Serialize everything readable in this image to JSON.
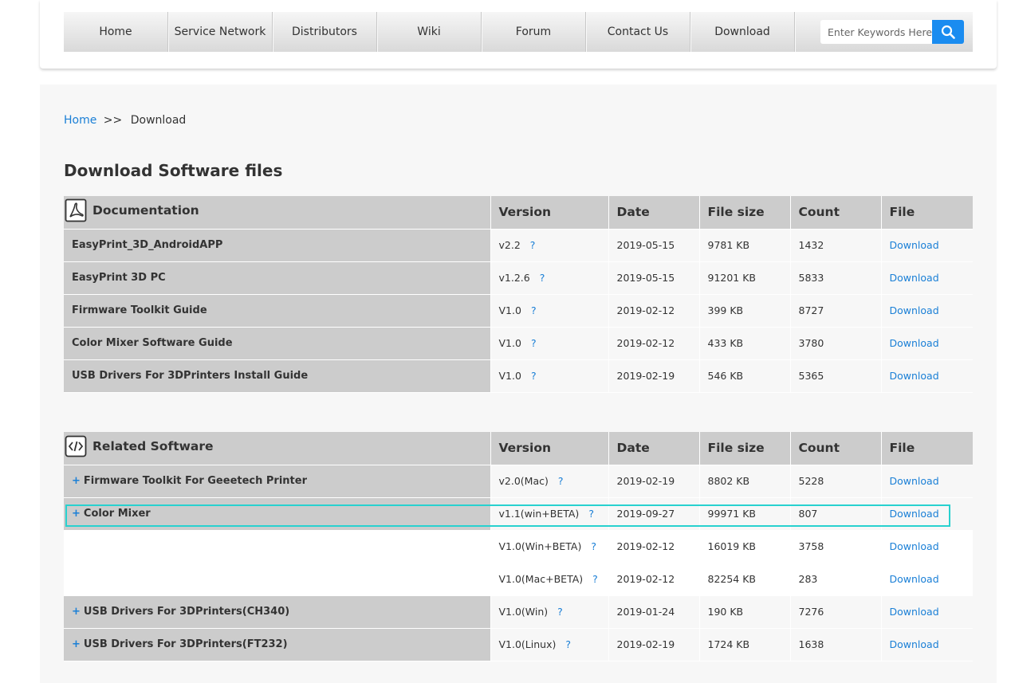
{
  "nav": {
    "items": [
      "Home",
      "Service Network",
      "Distributors",
      "Wiki",
      "Forum",
      "Contact Us",
      "Download"
    ],
    "search_placeholder": "Enter Keywords Here"
  },
  "breadcrumb": {
    "home": "Home",
    "separator": ">>",
    "current": "Download"
  },
  "page_title": "Download Software files",
  "columns": [
    "Version",
    "Date",
    "File size",
    "Count",
    "File"
  ],
  "documentation": {
    "title": "Documentation",
    "icon": "pdf-icon",
    "rows": [
      {
        "name": "EasyPrint_3D_AndroidAPP",
        "version": "v2.2",
        "date": "2019-05-15",
        "size": "9781 KB",
        "count": "1432",
        "file": "Download"
      },
      {
        "name": "EasyPrint 3D PC",
        "version": "v1.2.6",
        "date": "2019-05-15",
        "size": "91201 KB",
        "count": "5833",
        "file": "Download"
      },
      {
        "name": "Firmware Toolkit Guide",
        "version": "V1.0",
        "date": "2019-02-12",
        "size": "399 KB",
        "count": "8727",
        "file": "Download"
      },
      {
        "name": "Color Mixer Software Guide",
        "version": "V1.0",
        "date": "2019-02-12",
        "size": "433 KB",
        "count": "3780",
        "file": "Download"
      },
      {
        "name": "USB Drivers For 3DPrinters Install Guide",
        "version": "V1.0",
        "date": "2019-02-19",
        "size": "546 KB",
        "count": "5365",
        "file": "Download"
      }
    ]
  },
  "related_software": {
    "title": "Related Software",
    "icon": "code-icon",
    "rows": [
      {
        "name": "Firmware Toolkit For Geeetech Printer",
        "version": "v2.0(Mac)",
        "date": "2019-02-19",
        "size": "8802 KB",
        "count": "5228",
        "file": "Download"
      },
      {
        "name": "Color Mixer",
        "version": "v1.1(win+BETA)",
        "date": "2019-09-27",
        "size": "99971 KB",
        "count": "807",
        "file": "Download"
      },
      {
        "name": "",
        "version": "V1.0(Win+BETA)",
        "date": "2019-02-12",
        "size": "16019 KB",
        "count": "3758",
        "file": "Download"
      },
      {
        "name": "",
        "version": "V1.0(Mac+BETA)",
        "date": "2019-02-12",
        "size": "82254 KB",
        "count": "283",
        "file": "Download"
      },
      {
        "name": "USB Drivers For 3DPrinters(CH340)",
        "version": "V1.0(Win)",
        "date": "2019-01-24",
        "size": "190 KB",
        "count": "7276",
        "file": "Download"
      },
      {
        "name": "USB Drivers For 3DPrinters(FT232)",
        "version": "V1.0(Linux)",
        "date": "2019-02-19",
        "size": "1724 KB",
        "count": "1638",
        "file": "Download"
      }
    ]
  },
  "expand_symbol": "+",
  "help_symbol": "?",
  "colors": {
    "accent": "#1a8cf0",
    "link": "#1a7fd6",
    "header_bg": "#cccccc",
    "highlight": "#28d1cf"
  }
}
